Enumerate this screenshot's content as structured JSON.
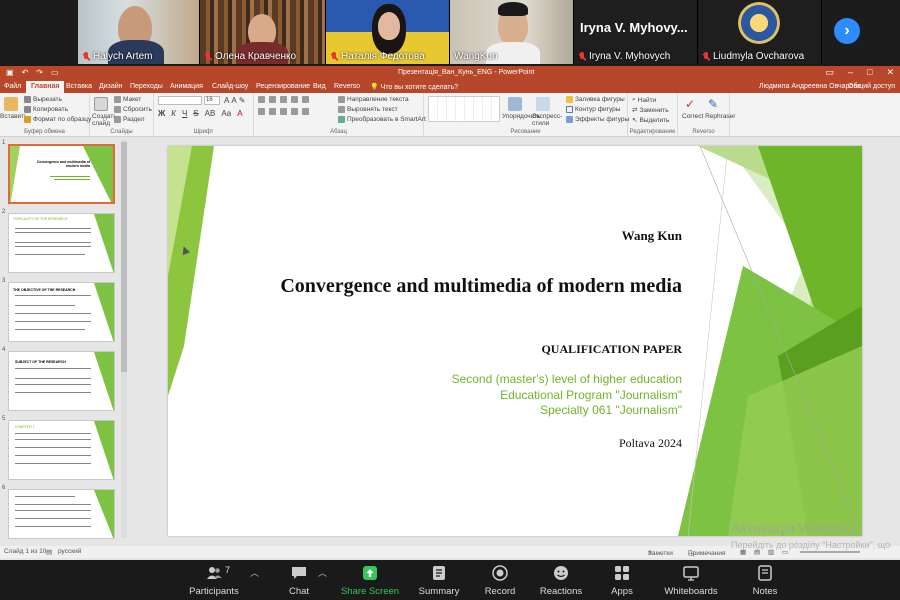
{
  "participants_strip": [
    {
      "name": "Halych Artem",
      "muted": true
    },
    {
      "name": "Олена Кравченко",
      "muted": true
    },
    {
      "name": "Наталія Федотова",
      "muted": true
    },
    {
      "name": "WangKun",
      "muted": false
    },
    {
      "name": "Iryna V. Myhovych",
      "display_name": "Iryna V. Myhovy...",
      "muted": true
    },
    {
      "name": "Liudmyla Ovcharova",
      "muted": true
    }
  ],
  "powerpoint": {
    "window_title": "Презентація_Ван_Кунь_ENG - PowerPoint",
    "menu_tabs": [
      "Файл",
      "Главная",
      "Вставка",
      "Дизайн",
      "Переходы",
      "Анимация",
      "Слайд-шоу",
      "Рецензирование",
      "Вид",
      "Reverso"
    ],
    "active_tab": "Главная",
    "search_hint": "Что вы хотите сделать?",
    "user": "Людмила Андреевна Овчарова",
    "share": "Общий доступ",
    "ribbon": {
      "clipboard": {
        "paste": "Вставить",
        "cut": "Вырезать",
        "copy": "Копировать",
        "format": "Формат по образцу",
        "group": "Буфер обмена"
      },
      "slides": {
        "new_slide": "Создать слайд",
        "layout": "Макет",
        "reset": "Сбросить",
        "section": "Раздел",
        "group": "Слайды"
      },
      "font": {
        "group": "Шрифт",
        "size": "16"
      },
      "paragraph": {
        "direction": "Направление текста",
        "align": "Выровнять текст",
        "smartart": "Преобразовать в SmartArt",
        "group": "Абзац"
      },
      "drawing": {
        "arrange": "Упорядочить",
        "styles": "Экспресс-стили",
        "fill": "Заливка фигуры",
        "outline": "Контур фигуры",
        "effects": "Эффекты фигуры",
        "group": "Рисование"
      },
      "editing": {
        "find": "Найти",
        "replace": "Заменить",
        "select": "Выделить",
        "group": "Редактирование"
      },
      "reverso": {
        "label": "Correct Rephraser",
        "group": "Reverso"
      }
    },
    "thumbnails": [
      {
        "num": "1",
        "heading": "Convergence and multimedia of modern media"
      },
      {
        "num": "2",
        "heading": "TOPICALITY OF THE RESEARCH"
      },
      {
        "num": "3",
        "heading": "THE OBJECTIVE OF THE RESEARCH"
      },
      {
        "num": "4",
        "heading": "SUBJECT OF THE RESEARCH"
      },
      {
        "num": "5",
        "heading": "CHAPTER 1"
      },
      {
        "num": "6",
        "heading": ""
      }
    ],
    "slide": {
      "author": "Wang Kun",
      "title": "Convergence and multimedia of modern media",
      "subtitle": "QUALIFICATION PAPER",
      "green_lines": [
        "Second (master's) level of higher education",
        "Educational Program \"Journalism\"",
        "Specialty 061 \"Journalism\""
      ],
      "city": "Poltava 2024"
    },
    "status": {
      "slide_counter": "Слайд 1 из 10",
      "language": "русский",
      "notes": "Заметки",
      "comments": "Примечания"
    }
  },
  "watermark": {
    "line1": "Активація Windows",
    "line2": "Перейдіть до розділу \"Настройки\", щоб активувати Windows."
  },
  "zoom_toolbar": {
    "participants_count": "7",
    "buttons": [
      {
        "id": "participants",
        "label": "Participants"
      },
      {
        "id": "chat",
        "label": "Chat"
      },
      {
        "id": "share",
        "label": "Share Screen"
      },
      {
        "id": "summary",
        "label": "Summary"
      },
      {
        "id": "record",
        "label": "Record"
      },
      {
        "id": "reactions",
        "label": "Reactions"
      },
      {
        "id": "apps",
        "label": "Apps"
      },
      {
        "id": "whiteboards",
        "label": "Whiteboards"
      },
      {
        "id": "notes",
        "label": "Notes"
      }
    ]
  },
  "colors": {
    "ppt_accent": "#b7472a",
    "slide_green": "#6fb52a",
    "zoom_share": "#35c75a",
    "zoom_blue": "#2d8cff"
  }
}
